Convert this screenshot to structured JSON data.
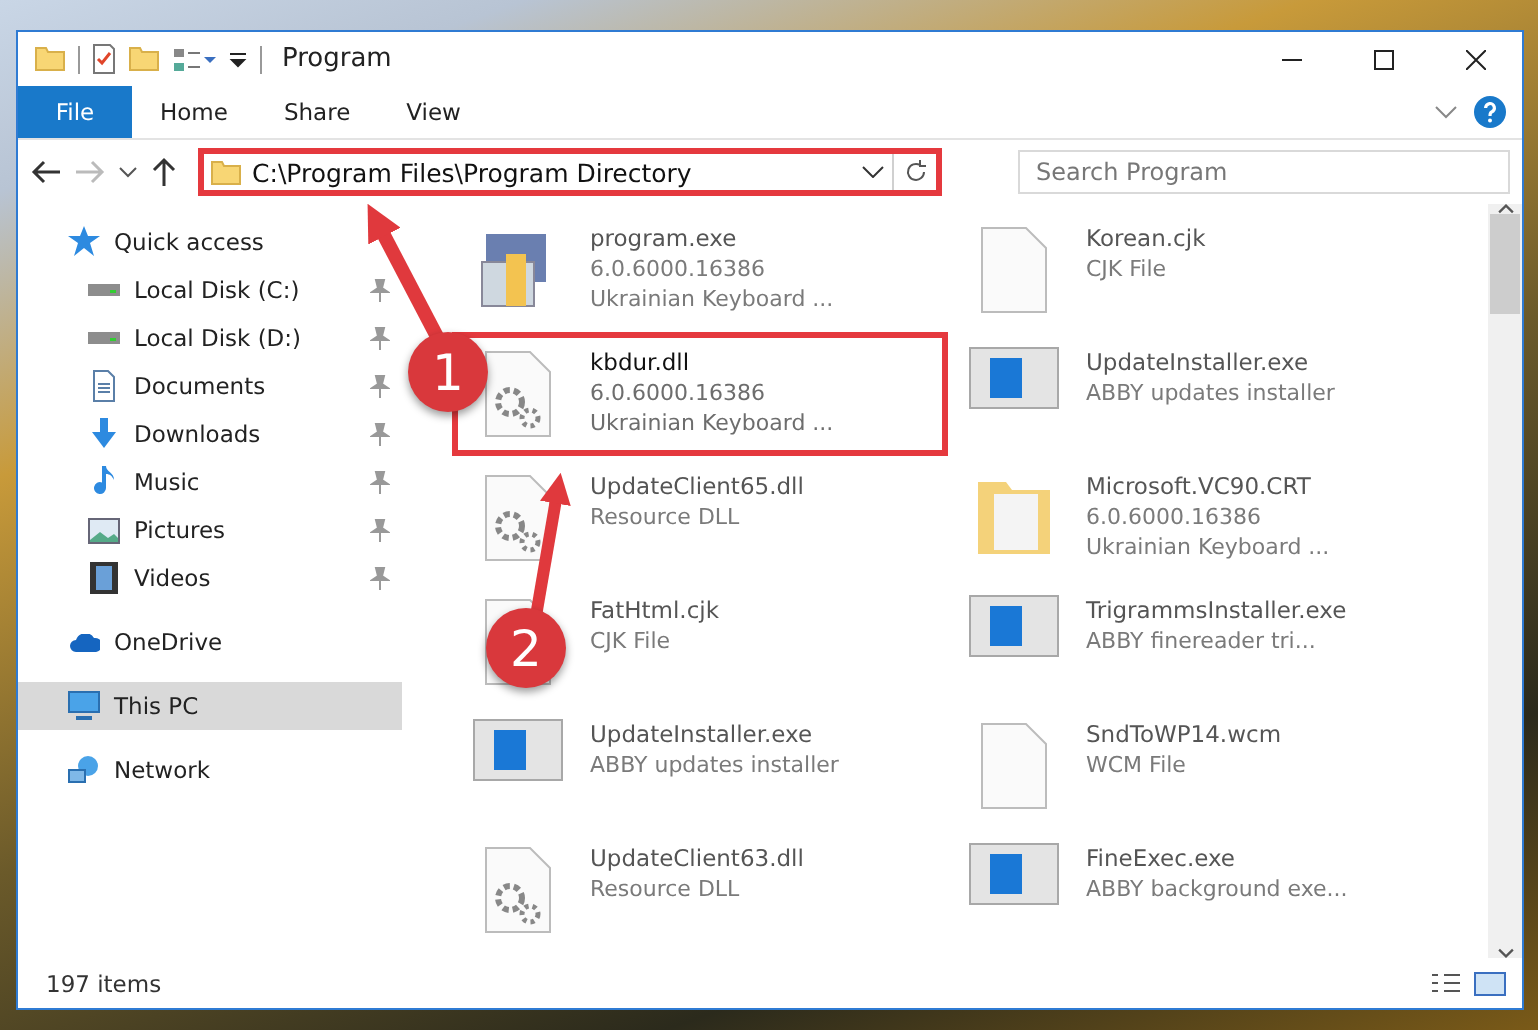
{
  "window": {
    "title": "Program"
  },
  "ribbon_tabs": [
    {
      "label": "File",
      "kind": "menu"
    },
    {
      "label": "Home",
      "kind": "tab"
    },
    {
      "label": "Share",
      "kind": "tab"
    },
    {
      "label": "View",
      "kind": "tab"
    }
  ],
  "address": {
    "path": "C:\\Program Files\\Program Directory"
  },
  "search": {
    "placeholder": "Search Program"
  },
  "sidebar": {
    "items": [
      {
        "label": "Quick access",
        "selected": false,
        "children": [
          {
            "label": "Local Disk (C:)",
            "pinned": true,
            "selected": false
          },
          {
            "label": "Local Disk (D:)",
            "pinned": true,
            "selected": false
          },
          {
            "label": "Documents",
            "pinned": true,
            "selected": false
          },
          {
            "label": "Downloads",
            "pinned": true,
            "selected": false
          },
          {
            "label": "Music",
            "pinned": true,
            "selected": false
          },
          {
            "label": "Pictures",
            "pinned": true,
            "selected": false
          },
          {
            "label": "Videos",
            "pinned": true,
            "selected": false
          }
        ]
      },
      {
        "label": "OneDrive",
        "selected": false
      },
      {
        "label": "This PC",
        "selected": true
      },
      {
        "label": "Network",
        "selected": false
      }
    ]
  },
  "files": [
    {
      "name": "program.exe",
      "details": [
        "6.0.6000.16386",
        "Ukrainian Keyboard ..."
      ],
      "kind": "app",
      "focused": false
    },
    {
      "name": "Korean.cjk",
      "details": [
        "CJK File"
      ],
      "kind": "plain",
      "focused": false
    },
    {
      "name": "kbdur.dll",
      "details": [
        "6.0.6000.16386",
        "Ukrainian Keyboard ..."
      ],
      "kind": "dll",
      "focused": true
    },
    {
      "name": "UpdateInstaller.exe",
      "details": [
        "ABBY updates installer"
      ],
      "kind": "installer",
      "focused": false
    },
    {
      "name": "UpdateClient65.dll",
      "details": [
        "Resource DLL"
      ],
      "kind": "dll",
      "focused": false
    },
    {
      "name": "Microsoft.VC90.CRT",
      "details": [
        "6.0.6000.16386",
        "Ukrainian Keyboard ..."
      ],
      "kind": "folder",
      "focused": false
    },
    {
      "name": "FatHtml.cjk",
      "details": [
        "CJK File"
      ],
      "kind": "plain",
      "focused": false
    },
    {
      "name": "TrigrammsInstaller.exe",
      "details": [
        "ABBY finereader tri..."
      ],
      "kind": "installer",
      "focused": false
    },
    {
      "name": "UpdateInstaller.exe",
      "details": [
        "ABBY updates installer"
      ],
      "kind": "installer",
      "focused": false
    },
    {
      "name": "SndToWP14.wcm",
      "details": [
        "WCM File"
      ],
      "kind": "plain",
      "focused": false
    },
    {
      "name": "UpdateClient63.dll",
      "details": [
        "Resource DLL"
      ],
      "kind": "dll",
      "focused": false
    },
    {
      "name": "FineExec.exe",
      "details": [
        "ABBY background exe..."
      ],
      "kind": "installer",
      "focused": false
    }
  ],
  "status_bar": {
    "count": "197 items"
  },
  "callouts": [
    {
      "number": "1"
    },
    {
      "number": "2"
    }
  ]
}
